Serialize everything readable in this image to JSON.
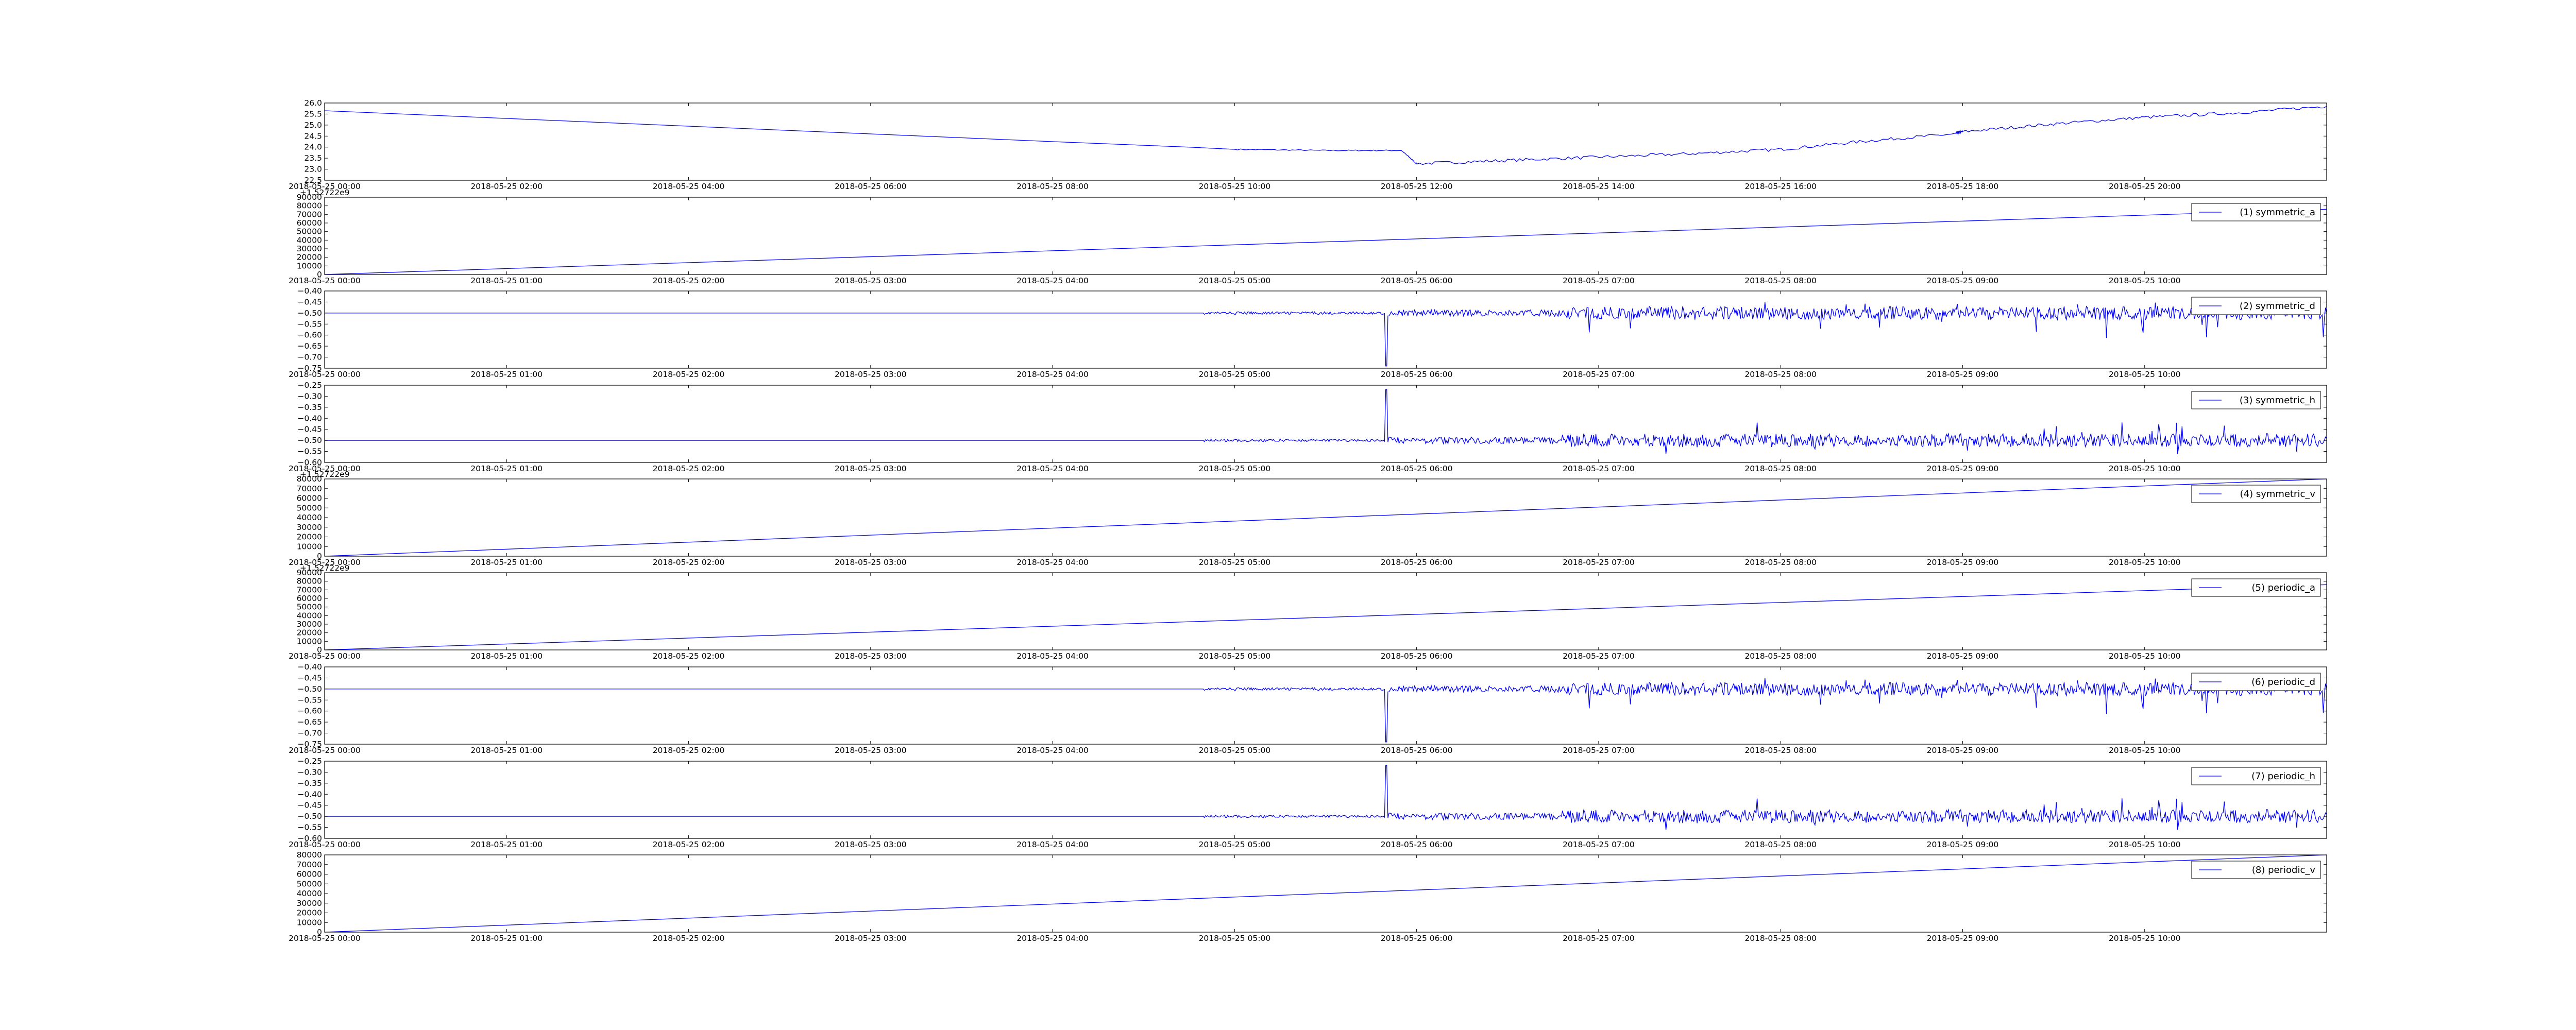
{
  "figure": {
    "background": "#ffffff",
    "line_color": "#0000ff",
    "axis_color": "#000000"
  },
  "chart_data": [
    {
      "type": "line",
      "title": "",
      "xlabel": "",
      "ylabel": "",
      "x_ticks": [
        "2018-05-25 00:00",
        "2018-05-25 02:00",
        "2018-05-25 04:00",
        "2018-05-25 06:00",
        "2018-05-25 08:00",
        "2018-05-25 10:00",
        "2018-05-25 12:00",
        "2018-05-25 14:00",
        "2018-05-25 16:00",
        "2018-05-25 18:00",
        "2018-05-25 20:00"
      ],
      "x_range": [
        "2018-05-25 00:00",
        "2018-05-25 22:00"
      ],
      "y_ticks": [
        "22.5",
        "23.0",
        "23.5",
        "24.0",
        "24.5",
        "25.0",
        "25.5",
        "26.0"
      ],
      "ylim": [
        22.5,
        26.0
      ],
      "offset_label": "",
      "legend": "",
      "grid": false,
      "series": [
        {
          "kind": "temp",
          "x": [
            "2018-05-25 00:00",
            "2018-05-25 02:00",
            "2018-05-25 04:00",
            "2018-05-25 06:00",
            "2018-05-25 08:00",
            "2018-05-25 09:30",
            "2018-05-25 10:00",
            "2018-05-25 11:00",
            "2018-05-25 11:50",
            "2018-05-25 12:00",
            "2018-05-25 13:00",
            "2018-05-25 14:00",
            "2018-05-25 15:00",
            "2018-05-25 16:00",
            "2018-05-25 17:00",
            "2018-05-25 17:55",
            "2018-05-25 18:00",
            "2018-05-25 19:00",
            "2018-05-25 20:00",
            "2018-05-25 21:00",
            "2018-05-25 22:00"
          ],
          "values": [
            25.65,
            25.3,
            24.95,
            24.6,
            24.25,
            24.0,
            23.9,
            23.85,
            23.85,
            23.25,
            23.4,
            23.55,
            23.7,
            23.9,
            24.3,
            24.6,
            24.7,
            25.05,
            25.35,
            25.55,
            25.85
          ]
        }
      ]
    },
    {
      "type": "line",
      "title": "",
      "xlabel": "",
      "ylabel": "",
      "x_ticks": [
        "2018-05-25 00:00",
        "2018-05-25 01:00",
        "2018-05-25 02:00",
        "2018-05-25 03:00",
        "2018-05-25 04:00",
        "2018-05-25 05:00",
        "2018-05-25 06:00",
        "2018-05-25 07:00",
        "2018-05-25 08:00",
        "2018-05-25 09:00",
        "2018-05-25 10:00"
      ],
      "x_range": [
        "2018-05-25 00:00",
        "2018-05-25 11:00"
      ],
      "y_ticks": [
        "0",
        "10000",
        "20000",
        "30000",
        "40000",
        "50000",
        "60000",
        "70000",
        "80000",
        "90000"
      ],
      "ylim": [
        0,
        90000
      ],
      "offset_label": "+1.52722e9",
      "legend": "(1) symmetric_a",
      "grid": false,
      "series": [
        {
          "kind": "linear",
          "x": [
            "2018-05-25 00:00",
            "2018-05-25 11:00"
          ],
          "values": [
            0,
            76000
          ]
        }
      ]
    },
    {
      "type": "line",
      "title": "",
      "xlabel": "",
      "ylabel": "",
      "x_ticks": [
        "2018-05-25 00:00",
        "2018-05-25 01:00",
        "2018-05-25 02:00",
        "2018-05-25 03:00",
        "2018-05-25 04:00",
        "2018-05-25 05:00",
        "2018-05-25 06:00",
        "2018-05-25 07:00",
        "2018-05-25 08:00",
        "2018-05-25 09:00",
        "2018-05-25 10:00"
      ],
      "x_range": [
        "2018-05-25 00:00",
        "2018-05-25 11:00"
      ],
      "y_ticks": [
        "−0.75",
        "−0.70",
        "−0.65",
        "−0.60",
        "−0.55",
        "−0.50",
        "−0.45",
        "−0.40"
      ],
      "ylim": [
        -0.75,
        -0.4
      ],
      "offset_label": "",
      "legend": "(2) symmetric_d",
      "grid": false,
      "series": [
        {
          "kind": "noise_d",
          "baseline": -0.5,
          "noise_start": "2018-05-25 04:50",
          "spike": {
            "x": "2018-05-25 05:50",
            "value": -0.74
          },
          "range": [
            -0.65,
            -0.45
          ]
        }
      ]
    },
    {
      "type": "line",
      "title": "",
      "xlabel": "",
      "ylabel": "",
      "x_ticks": [
        "2018-05-25 00:00",
        "2018-05-25 01:00",
        "2018-05-25 02:00",
        "2018-05-25 03:00",
        "2018-05-25 04:00",
        "2018-05-25 05:00",
        "2018-05-25 06:00",
        "2018-05-25 07:00",
        "2018-05-25 08:00",
        "2018-05-25 09:00",
        "2018-05-25 10:00"
      ],
      "x_range": [
        "2018-05-25 00:00",
        "2018-05-25 11:00"
      ],
      "y_ticks": [
        "−0.60",
        "−0.55",
        "−0.50",
        "−0.45",
        "−0.40",
        "−0.35",
        "−0.30",
        "−0.25"
      ],
      "ylim": [
        -0.6,
        -0.25
      ],
      "offset_label": "",
      "legend": "(3) symmetric_h",
      "grid": false,
      "series": [
        {
          "kind": "noise_h",
          "baseline": -0.5,
          "noise_start": "2018-05-25 04:50",
          "spike": {
            "x": "2018-05-25 05:50",
            "value": -0.27
          },
          "range": [
            -0.57,
            -0.4
          ]
        }
      ]
    },
    {
      "type": "line",
      "title": "",
      "xlabel": "",
      "ylabel": "",
      "x_ticks": [
        "2018-05-25 00:00",
        "2018-05-25 01:00",
        "2018-05-25 02:00",
        "2018-05-25 03:00",
        "2018-05-25 04:00",
        "2018-05-25 05:00",
        "2018-05-25 06:00",
        "2018-05-25 07:00",
        "2018-05-25 08:00",
        "2018-05-25 09:00",
        "2018-05-25 10:00"
      ],
      "x_range": [
        "2018-05-25 00:00",
        "2018-05-25 11:00"
      ],
      "y_ticks": [
        "0",
        "10000",
        "20000",
        "30000",
        "40000",
        "50000",
        "60000",
        "70000",
        "80000"
      ],
      "ylim": [
        0,
        80000
      ],
      "offset_label": "+1.52722e9",
      "legend": "(4) symmetric_v",
      "grid": false,
      "series": [
        {
          "kind": "linear",
          "x": [
            "2018-05-25 00:00",
            "2018-05-25 11:00"
          ],
          "values": [
            0,
            80000
          ]
        }
      ]
    },
    {
      "type": "line",
      "title": "",
      "xlabel": "",
      "ylabel": "",
      "x_ticks": [
        "2018-05-25 00:00",
        "2018-05-25 01:00",
        "2018-05-25 02:00",
        "2018-05-25 03:00",
        "2018-05-25 04:00",
        "2018-05-25 05:00",
        "2018-05-25 06:00",
        "2018-05-25 07:00",
        "2018-05-25 08:00",
        "2018-05-25 09:00",
        "2018-05-25 10:00"
      ],
      "x_range": [
        "2018-05-25 00:00",
        "2018-05-25 11:00"
      ],
      "y_ticks": [
        "0",
        "10000",
        "20000",
        "30000",
        "40000",
        "50000",
        "60000",
        "70000",
        "80000",
        "90000"
      ],
      "ylim": [
        0,
        90000
      ],
      "offset_label": "+1.52722e9",
      "legend": "(5) periodic_a",
      "grid": false,
      "series": [
        {
          "kind": "linear",
          "x": [
            "2018-05-25 00:00",
            "2018-05-25 11:00"
          ],
          "values": [
            0,
            76000
          ]
        }
      ]
    },
    {
      "type": "line",
      "title": "",
      "xlabel": "",
      "ylabel": "",
      "x_ticks": [
        "2018-05-25 00:00",
        "2018-05-25 01:00",
        "2018-05-25 02:00",
        "2018-05-25 03:00",
        "2018-05-25 04:00",
        "2018-05-25 05:00",
        "2018-05-25 06:00",
        "2018-05-25 07:00",
        "2018-05-25 08:00",
        "2018-05-25 09:00",
        "2018-05-25 10:00"
      ],
      "x_range": [
        "2018-05-25 00:00",
        "2018-05-25 11:00"
      ],
      "y_ticks": [
        "−0.75",
        "−0.70",
        "−0.65",
        "−0.60",
        "−0.55",
        "−0.50",
        "−0.45",
        "−0.40"
      ],
      "ylim": [
        -0.75,
        -0.4
      ],
      "offset_label": "",
      "legend": "(6) periodic_d",
      "grid": false,
      "series": [
        {
          "kind": "noise_d",
          "baseline": -0.5,
          "noise_start": "2018-05-25 04:50",
          "spike": {
            "x": "2018-05-25 05:50",
            "value": -0.74
          },
          "range": [
            -0.65,
            -0.45
          ]
        }
      ]
    },
    {
      "type": "line",
      "title": "",
      "xlabel": "",
      "ylabel": "",
      "x_ticks": [
        "2018-05-25 00:00",
        "2018-05-25 01:00",
        "2018-05-25 02:00",
        "2018-05-25 03:00",
        "2018-05-25 04:00",
        "2018-05-25 05:00",
        "2018-05-25 06:00",
        "2018-05-25 07:00",
        "2018-05-25 08:00",
        "2018-05-25 09:00",
        "2018-05-25 10:00"
      ],
      "x_range": [
        "2018-05-25 00:00",
        "2018-05-25 11:00"
      ],
      "y_ticks": [
        "−0.60",
        "−0.55",
        "−0.50",
        "−0.45",
        "−0.40",
        "−0.35",
        "−0.30",
        "−0.25"
      ],
      "ylim": [
        -0.6,
        -0.25
      ],
      "offset_label": "",
      "legend": "(7) periodic_h",
      "grid": false,
      "series": [
        {
          "kind": "noise_h",
          "baseline": -0.5,
          "noise_start": "2018-05-25 04:50",
          "spike": {
            "x": "2018-05-25 05:50",
            "value": -0.27
          },
          "range": [
            -0.57,
            -0.4
          ]
        }
      ]
    },
    {
      "type": "line",
      "title": "",
      "xlabel": "",
      "ylabel": "",
      "x_ticks": [
        "2018-05-25 00:00",
        "2018-05-25 01:00",
        "2018-05-25 02:00",
        "2018-05-25 03:00",
        "2018-05-25 04:00",
        "2018-05-25 05:00",
        "2018-05-25 06:00",
        "2018-05-25 07:00",
        "2018-05-25 08:00",
        "2018-05-25 09:00",
        "2018-05-25 10:00"
      ],
      "x_range": [
        "2018-05-25 00:00",
        "2018-05-25 11:00"
      ],
      "y_ticks": [
        "0",
        "10000",
        "20000",
        "30000",
        "40000",
        "50000",
        "60000",
        "70000",
        "80000"
      ],
      "ylim": [
        0,
        80000
      ],
      "offset_label": "",
      "legend": "(8) periodic_v",
      "grid": false,
      "series": [
        {
          "kind": "linear",
          "x": [
            "2018-05-25 00:00",
            "2018-05-25 11:00"
          ],
          "values": [
            0,
            80000
          ]
        }
      ]
    }
  ]
}
